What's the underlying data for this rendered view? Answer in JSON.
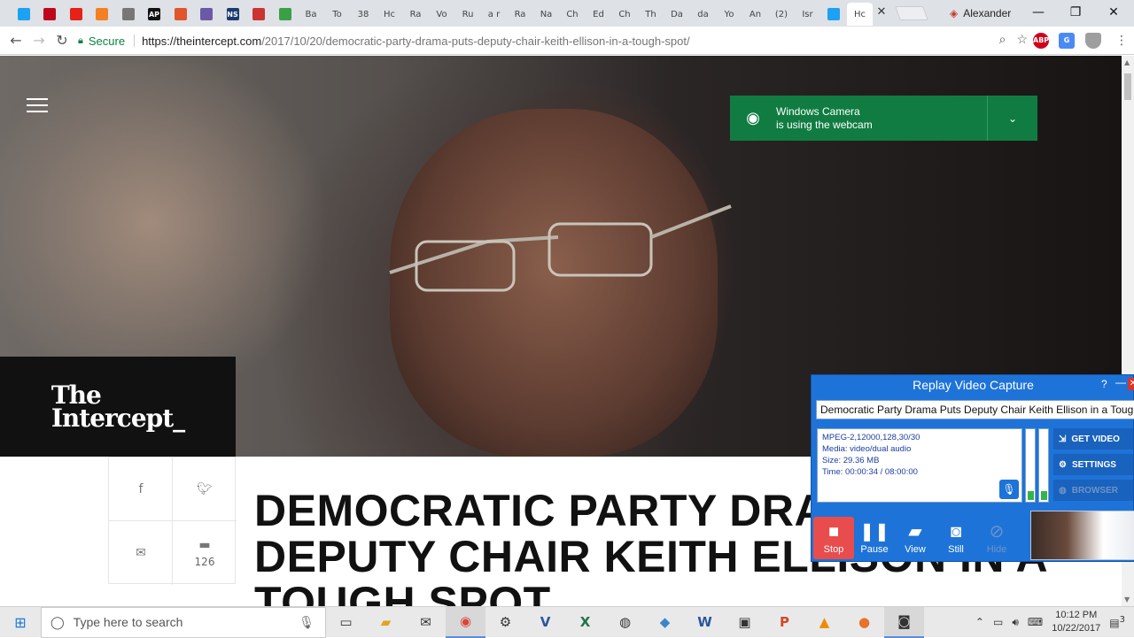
{
  "browser": {
    "tabs": [
      {
        "label": "",
        "icon": "twitter-icon",
        "color": "#1da1f2"
      },
      {
        "label": "",
        "icon": "pinterest-icon",
        "color": "#bd081c"
      },
      {
        "label": "",
        "icon": "youtube-icon",
        "color": "#e62117"
      },
      {
        "label": "",
        "icon": "stack-icon",
        "color": "#f48024"
      },
      {
        "label": "",
        "icon": "he-icon",
        "color": "#777777"
      },
      {
        "label": "AP",
        "icon": "ap-icon",
        "color": "#111111"
      },
      {
        "label": "",
        "icon": "swoosh-icon",
        "color": "#e0552b"
      },
      {
        "label": "",
        "icon": "nbc-icon",
        "color": "#6b59a8"
      },
      {
        "label": "NS",
        "icon": "ns-icon",
        "color": "#1a3b6e"
      },
      {
        "label": "",
        "icon": "news-icon",
        "color": "#cc3333"
      },
      {
        "label": "",
        "icon": "w-icon",
        "color": "#3aa047"
      },
      {
        "label": "Ba",
        "icon": "",
        "color": ""
      },
      {
        "label": "To",
        "icon": "",
        "color": ""
      },
      {
        "label": "38",
        "icon": "",
        "color": ""
      },
      {
        "label": "Hc",
        "icon": "",
        "color": ""
      },
      {
        "label": "Ra",
        "icon": "",
        "color": ""
      },
      {
        "label": "Vo",
        "icon": "",
        "color": ""
      },
      {
        "label": "Ru",
        "icon": "",
        "color": ""
      },
      {
        "label": "a r",
        "icon": "",
        "color": ""
      },
      {
        "label": "Ra",
        "icon": "",
        "color": ""
      },
      {
        "label": "Na",
        "icon": "",
        "color": ""
      },
      {
        "label": "Ch",
        "icon": "",
        "color": ""
      },
      {
        "label": "Ed",
        "icon": "",
        "color": ""
      },
      {
        "label": "Ch",
        "icon": "",
        "color": ""
      },
      {
        "label": "Th",
        "icon": "",
        "color": ""
      },
      {
        "label": "Da",
        "icon": "",
        "color": ""
      },
      {
        "label": "da",
        "icon": "",
        "color": ""
      },
      {
        "label": "Yo",
        "icon": "",
        "color": ""
      },
      {
        "label": "An",
        "icon": "",
        "color": ""
      },
      {
        "label": "(2)",
        "icon": "",
        "color": ""
      },
      {
        "label": "Isr",
        "icon": "",
        "color": ""
      },
      {
        "label": "",
        "icon": "twitter-icon",
        "color": "#1da1f2"
      },
      {
        "label": "Hc",
        "icon": "",
        "color": ""
      }
    ],
    "profile_name": "Alexander",
    "secure_label": "Secure",
    "url_host": "https://theintercept.com",
    "url_path": "/2017/10/20/democratic-party-drama-puts-deputy-chair-keith-ellison-in-a-tough-spot/"
  },
  "article": {
    "logo_line1": "The",
    "logo_line2": "Intercept_",
    "comment_count": "126",
    "headline": "DEMOCRATIC PARTY DRAMA PUTS DEPUTY CHAIR KEITH ELLISON IN A TOUGH SPOT"
  },
  "notification": {
    "line1": "Windows Camera",
    "line2": "is using the webcam"
  },
  "capture_app": {
    "title": "Replay Video Capture",
    "help": "?",
    "recording_name": "Democratic Party Drama Puts Deputy Chair Keith Ellison in a Tough S",
    "info_codec": "MPEG-2,12000,128,30/30",
    "info_media": "Media: video/dual audio",
    "info_size": "Size: 29.36  MB",
    "info_time": "Time: 00:00:34  / 08:00:00",
    "side_buttons": [
      "GET VIDEO",
      "SETTINGS",
      "BROWSER"
    ],
    "buttons": [
      "Stop",
      "Pause",
      "View",
      "Still",
      "Hide"
    ]
  },
  "taskbar": {
    "search_placeholder": "Type here to search",
    "time": "10:12 PM",
    "date": "10/22/2017",
    "notification_count": "3"
  }
}
